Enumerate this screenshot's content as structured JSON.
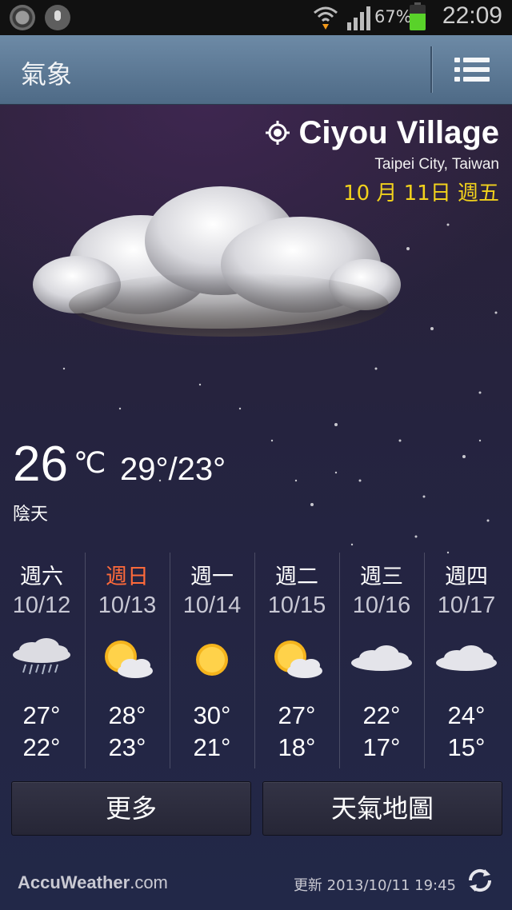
{
  "status_bar": {
    "battery_percent": "67%",
    "time": "22:09",
    "battery_level": 0.67
  },
  "action_bar": {
    "title": "氣象"
  },
  "location": {
    "name": "Ciyou Village",
    "region": "Taipei City, Taiwan",
    "date": "10 月 11日 週五"
  },
  "current": {
    "temp": "26",
    "unit": "℃",
    "high_low": "29°/23°",
    "condition": "陰天"
  },
  "forecast": [
    {
      "day": "週六",
      "date": "10/12",
      "icon": "rain-cloud-icon",
      "high": "27°",
      "low": "22°"
    },
    {
      "day": "週日",
      "date": "10/13",
      "icon": "sun-cloud-icon",
      "high": "28°",
      "low": "23°"
    },
    {
      "day": "週一",
      "date": "10/14",
      "icon": "sun-icon",
      "high": "30°",
      "low": "21°"
    },
    {
      "day": "週二",
      "date": "10/15",
      "icon": "sun-cloud-icon",
      "high": "27°",
      "low": "18°"
    },
    {
      "day": "週三",
      "date": "10/16",
      "icon": "cloud-icon",
      "high": "22°",
      "low": "17°"
    },
    {
      "day": "週四",
      "date": "10/17",
      "icon": "cloud-icon",
      "high": "24°",
      "low": "15°"
    }
  ],
  "buttons": {
    "more": "更多",
    "map": "天氣地圖"
  },
  "footer": {
    "brand_bold": "AccuWeather",
    "brand_suffix": ".com",
    "updated": "更新 2013/10/11 19:45"
  },
  "colors": {
    "sunday": "#ff6a3a",
    "date_accent": "#f2d21c",
    "action_bar": "#5a7794"
  }
}
